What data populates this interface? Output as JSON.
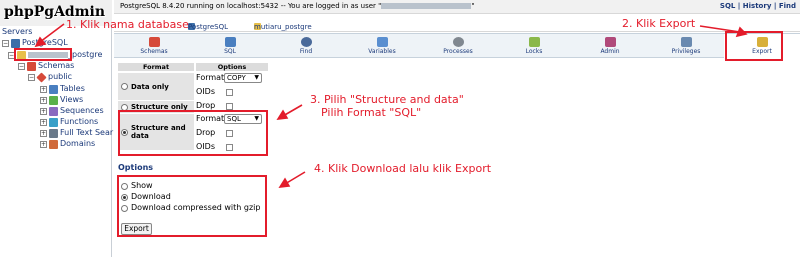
{
  "app": {
    "logo": "phpPgAdmin"
  },
  "sidebar": {
    "servers": "Servers",
    "server": "PostgreSQL",
    "database_suffix": "_postgre",
    "schemas": "Schemas",
    "public": "public",
    "items": [
      "Tables",
      "Views",
      "Sequences",
      "Functions",
      "Full Text Sear",
      "Domains"
    ]
  },
  "topbar": {
    "info": "PostgreSQL 8.4.20 running on localhost:5432 -- You are logged in as user \"",
    "info_end": "\"",
    "links": "SQL | History | Find"
  },
  "breadcrumb": {
    "server": "PostgreSQL",
    "db": "mutiaru_postgre"
  },
  "tabs": [
    {
      "label": "Schemas"
    },
    {
      "label": "SQL"
    },
    {
      "label": "Find"
    },
    {
      "label": "Variables"
    },
    {
      "label": "Processes"
    },
    {
      "label": "Locks"
    },
    {
      "label": "Admin"
    },
    {
      "label": "Privileges"
    },
    {
      "label": "Export"
    }
  ],
  "format_table": {
    "header_format": "Format",
    "header_options": "Options",
    "rows": [
      {
        "label": "Data only",
        "format_label": "Format",
        "format_value": "COPY",
        "oids": "OIDs",
        "drop": null
      },
      {
        "label": "Structure only",
        "format_label": null,
        "format_value": null,
        "oids": null,
        "drop": "Drop"
      },
      {
        "label": "Structure and data",
        "format_label": "Format",
        "format_value": "SQL",
        "oids": "OIDs",
        "drop": "Drop"
      }
    ]
  },
  "options": {
    "title": "Options",
    "choices": [
      "Show",
      "Download",
      "Download compressed with gzip"
    ],
    "selected": "Download",
    "export_button": "Export"
  },
  "annotations": {
    "a1": "1. Klik nama database",
    "a2": "2. Klik Export",
    "a3_line1": "3. Pilih \"Structure and data\"",
    "a3_line2": "Pilih Format \"SQL\"",
    "a4": "4. Klik Download lalu klik Export"
  },
  "colors": {
    "annotation_red": "#e31c2b",
    "link_blue": "#1c3a7a"
  }
}
